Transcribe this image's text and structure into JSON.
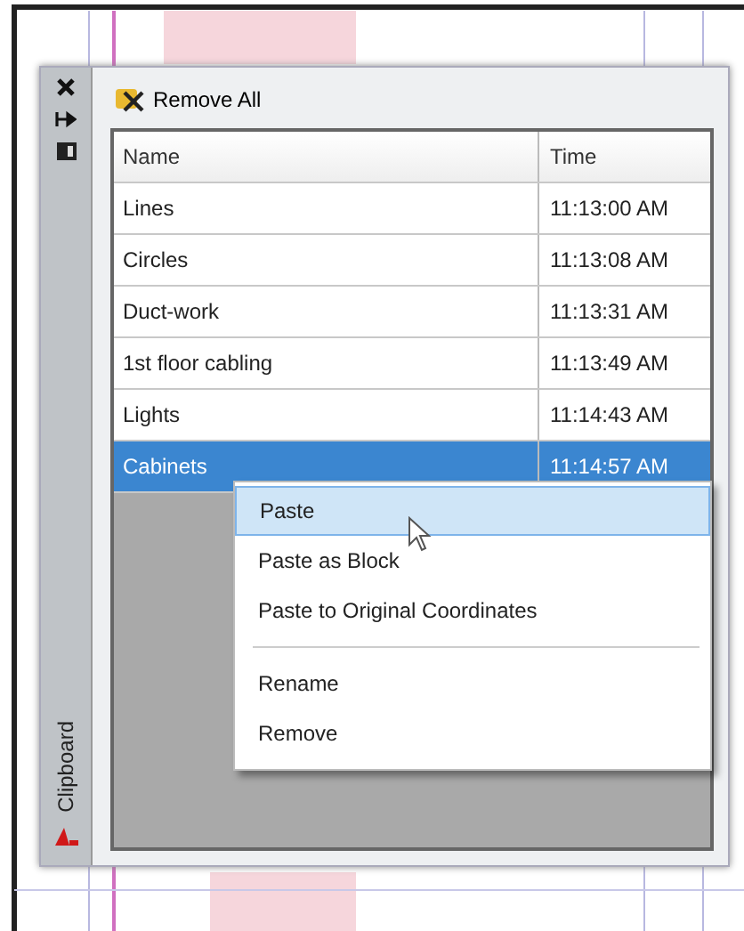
{
  "side_strip": {
    "title": "Clipboard"
  },
  "toolbar": {
    "remove_all": "Remove All"
  },
  "table": {
    "columns": [
      "Name",
      "Time"
    ],
    "rows": [
      {
        "name": "Lines",
        "time": "11:13:00 AM",
        "selected": false
      },
      {
        "name": "Circles",
        "time": "11:13:08 AM",
        "selected": false
      },
      {
        "name": "Duct-work",
        "time": "11:13:31 AM",
        "selected": false
      },
      {
        "name": "1st floor cabling",
        "time": "11:13:49 AM",
        "selected": false
      },
      {
        "name": "Lights",
        "time": "11:14:43 AM",
        "selected": false
      },
      {
        "name": "Cabinets",
        "time": "11:14:57 AM",
        "selected": true
      }
    ]
  },
  "context_menu": {
    "sections": [
      [
        {
          "label": "Paste",
          "selected": true
        },
        {
          "label": "Paste as Block",
          "selected": false
        },
        {
          "label": "Paste to Original Coordinates",
          "selected": false
        }
      ],
      [
        {
          "label": "Rename",
          "selected": false
        },
        {
          "label": "Remove",
          "selected": false
        }
      ]
    ]
  }
}
